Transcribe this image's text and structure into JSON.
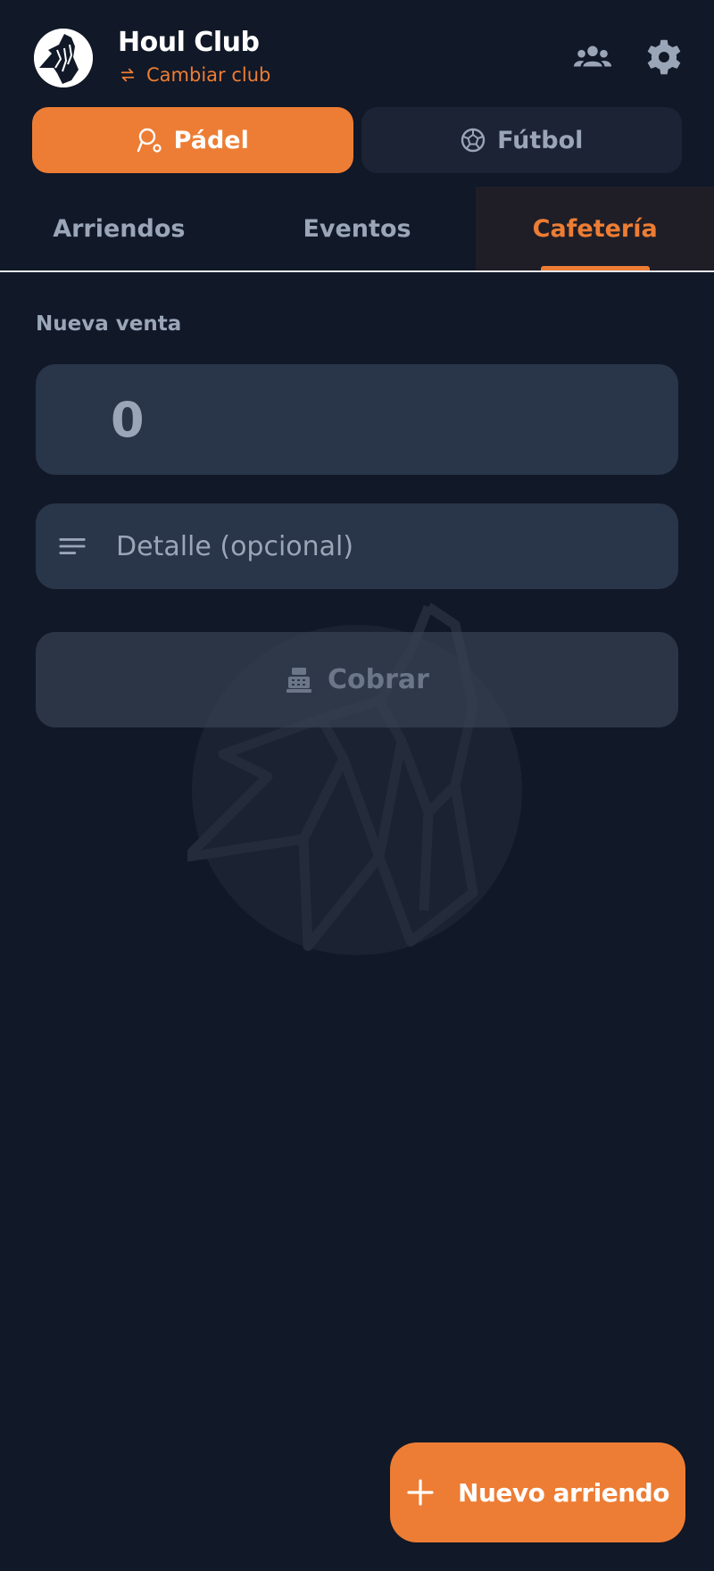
{
  "header": {
    "club_name": "Houl Club",
    "switch_club_label": "Cambiar club",
    "people_icon": "people-icon",
    "settings_icon": "gear-icon",
    "logo_icon": "wolf-logo"
  },
  "sports": [
    {
      "label": "Pádel",
      "icon": "padel-racket-icon",
      "active": true
    },
    {
      "label": "Fútbol",
      "icon": "soccer-ball-icon",
      "active": false
    }
  ],
  "tabs": [
    {
      "label": "Arriendos",
      "active": false
    },
    {
      "label": "Eventos",
      "active": false
    },
    {
      "label": "Cafetería",
      "active": true
    }
  ],
  "sale": {
    "section_label": "Nueva venta",
    "amount_value": "0",
    "detail_placeholder": "Detalle (opcional)",
    "charge_label": "Cobrar",
    "charge_icon": "cash-register-icon"
  },
  "fab": {
    "label": "Nuevo arriendo",
    "icon": "plus-icon"
  },
  "colors": {
    "accent": "#ed7d34",
    "background": "#111827",
    "field": "#293548",
    "muted_text": "#9aa6b8"
  }
}
